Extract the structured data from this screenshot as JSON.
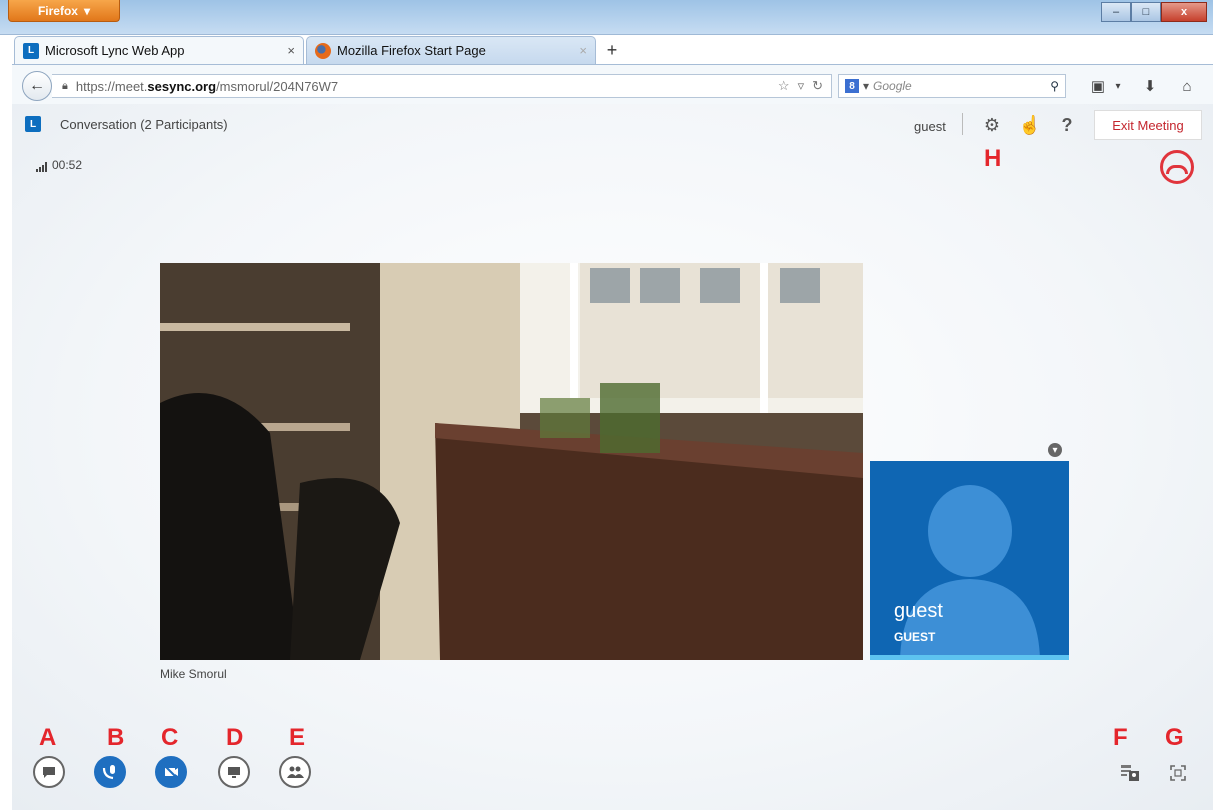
{
  "browser": {
    "menu_label": "Firefox",
    "tabs": [
      {
        "label": "Microsoft Lync Web App",
        "close": "×"
      },
      {
        "label": "Mozilla Firefox Start Page",
        "close": "×"
      }
    ],
    "new_tab": "+",
    "url": {
      "prefix": "https://meet.",
      "domain": "sesync.org",
      "path": "/msmorul/204N76W7"
    },
    "search": {
      "engine_badge": "8",
      "placeholder": "Google"
    },
    "window_buttons": {
      "min": "–",
      "max": "□",
      "close": "x"
    }
  },
  "lync": {
    "conversation_title": "Conversation (2 Participants)",
    "user": "guest",
    "exit_label": "Exit Meeting",
    "call_duration": "00:52",
    "annotation_H": "H",
    "video": {
      "participant_name": "Mike Smorul"
    },
    "self_tile": {
      "name": "guest",
      "role": "GUEST"
    },
    "bottom_left": [
      {
        "letter": "A",
        "icon": "im-icon"
      },
      {
        "letter": "B",
        "icon": "audio-icon"
      },
      {
        "letter": "C",
        "icon": "video-icon"
      },
      {
        "letter": "D",
        "icon": "present-icon"
      },
      {
        "letter": "E",
        "icon": "participants-icon"
      }
    ],
    "bottom_right": [
      {
        "letter": "F",
        "icon": "content-layout-icon"
      },
      {
        "letter": "G",
        "icon": "fullscreen-icon"
      }
    ]
  },
  "colors": {
    "accent": "#1f6fc0",
    "exit_red": "#c4262e",
    "annotation_red": "#e4262c",
    "tile_blue": "#0f66b3"
  }
}
